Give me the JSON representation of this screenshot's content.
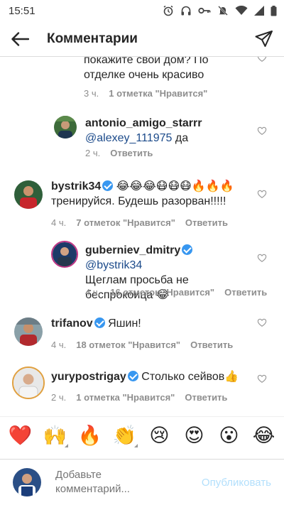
{
  "status_bar": {
    "time": "15:51"
  },
  "header": {
    "title": "Комментарии"
  },
  "comments": [
    {
      "username": "",
      "text": "покажите свой дом? По отделке очень красиво",
      "time": "3 ч.",
      "likes": "1 отметка \"Нравится\"",
      "reply": ""
    },
    {
      "username": "antonio_amigo_starrr",
      "mention": "@alexey_111975",
      "text": " да",
      "time": "2 ч.",
      "reply": "Ответить"
    },
    {
      "username": "bystrik34",
      "text": "😂😂😂😷😷😷🔥🔥🔥 тренируйся. Будешь разорван!!!!!",
      "time": "4 ч.",
      "likes": "7 отметок \"Нравится\"",
      "reply": "Ответить"
    },
    {
      "username": "guberniev_dmitry",
      "mention": "@bystrik34",
      "text": "Щеглам просьба не беспрокоица 😂",
      "time": "4 ч.",
      "likes": "16 отметок \"Нравится\"",
      "reply": "Ответить"
    },
    {
      "username": "trifanov",
      "text": "Яшин!",
      "time": "4 ч.",
      "likes": "18 отметок \"Нравится\"",
      "reply": "Ответить"
    },
    {
      "username": "yurypostrigay",
      "text": "Столько сейвов👍",
      "time": "2 ч.",
      "likes": "1 отметка \"Нравится\"",
      "reply": "Ответить"
    }
  ],
  "emoji_bar": [
    "❤️",
    "🙌",
    "🔥",
    "👏",
    "😢",
    "😍",
    "😮",
    "😂"
  ],
  "composer": {
    "placeholder": "Добавьте комментарий...",
    "publish_label": "Опубликовать"
  },
  "colors": {
    "link": "#1b4a8a",
    "verified": "#3897f0",
    "publish_disabled": "#b2dffc"
  }
}
